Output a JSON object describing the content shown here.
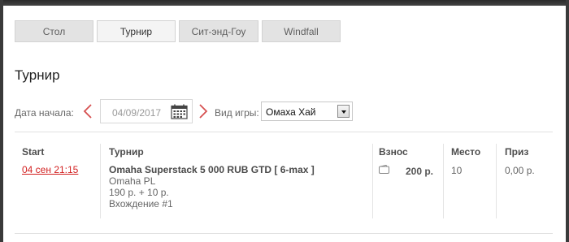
{
  "tabs": [
    {
      "label": "Стол",
      "active": false
    },
    {
      "label": "Турнир",
      "active": true
    },
    {
      "label": "Сит-энд-Гоу",
      "active": false
    },
    {
      "label": "Windfall",
      "active": false
    }
  ],
  "page_title": "Турнир",
  "filters": {
    "start_date_label": "Дата начала:",
    "date_value": "04/09/2017",
    "game_type_label": "Вид игры:",
    "game_type_value": "Омаха Хай"
  },
  "table": {
    "columns": [
      "Start",
      "Турнир",
      "Взнос",
      "Место",
      "Приз"
    ],
    "rows": [
      {
        "start": "04 сен 21:15",
        "tournament_name": "Omaha Superstack 5 000 RUB GTD [ 6-max ]",
        "game": "Omaha PL",
        "buyin": "190 р. + 10 р.",
        "entry": "Вхождение #1",
        "fee": "200 р.",
        "place": "10",
        "prize": "0,00 р."
      }
    ]
  },
  "colors": {
    "accent_red": "#d21f1f",
    "tab_bg": "#e3e3e3",
    "active_tab_bg": "#f4f4f4"
  },
  "icons": {
    "prev": "chevron-left-icon",
    "next": "chevron-right-icon",
    "calendar": "calendar-icon",
    "wallet": "wallet-icon",
    "dropdown": "dropdown-arrow-icon"
  }
}
